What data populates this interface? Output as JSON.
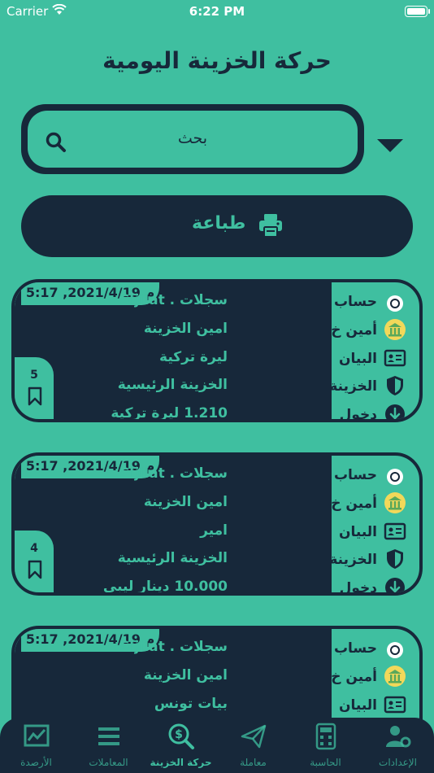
{
  "status_bar": {
    "carrier": "Carrier",
    "time": "6:22 PM"
  },
  "page": {
    "title": "حركة الخزينة اليومية"
  },
  "search": {
    "placeholder": "بحث"
  },
  "print_button": {
    "label": "طباعة"
  },
  "labels": {
    "account": "حساب",
    "treasurer": "أمين خ.",
    "statement": "البيان",
    "treasury": "الخزينة",
    "entry": "دخول"
  },
  "cards": [
    {
      "date": "5:17 ,2021/4/19 م",
      "account": "سجلات . Sijilat",
      "treasurer": "امين الخزينة",
      "statement": "ليرة تركية",
      "treasury": "الخزينة الرئيسية",
      "amount": "1.210 ليرة تركية",
      "count": "5"
    },
    {
      "date": "5:17 ,2021/4/19 م",
      "account": "سجلات . Sijilat",
      "treasurer": "امين الخزينة",
      "statement": "امير",
      "treasury": "الخزينة الرئيسية",
      "amount": "10.000 دينار ليبي",
      "count": "4"
    },
    {
      "date": "5:17 ,2021/4/19 م",
      "account": "سجلات . Sijilat",
      "treasurer": "امين الخزينة",
      "statement": "بيات تونس"
    }
  ],
  "tabbar": {
    "settings": "الإعدادات",
    "calculator": "الحاسبة",
    "transaction": "معاملة",
    "treasury_movement": "حركة الخزينة",
    "transactions": "المعاملات",
    "balances": "الأرصدة"
  },
  "colors": {
    "background": "#3fbfa0",
    "dark": "#17283a",
    "accent": "#3fbfa0"
  }
}
